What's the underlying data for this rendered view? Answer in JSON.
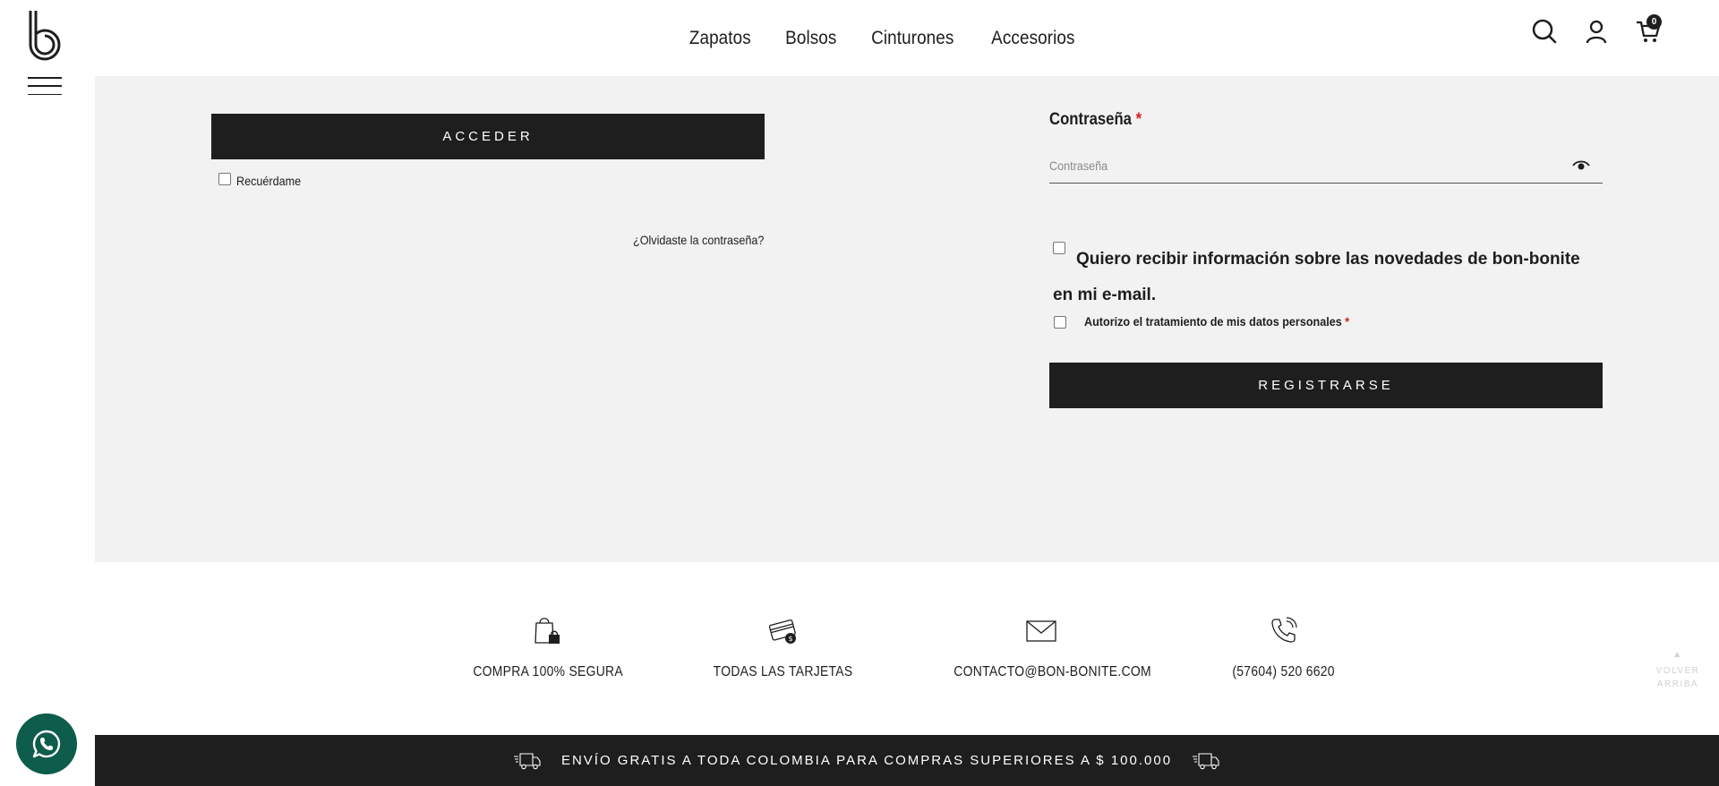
{
  "nav": {
    "items": [
      {
        "label": "Zapatos"
      },
      {
        "label": "Bolsos"
      },
      {
        "label": "Cinturones"
      },
      {
        "label": "Accesorios"
      }
    ],
    "cart_count": "0"
  },
  "login": {
    "submit_label": "ACCEDER",
    "remember_label": "Recuérdame",
    "forgot_label": "¿Olvidaste la contraseña?"
  },
  "register": {
    "password_label": "Contraseña",
    "required_mark": "*",
    "password_placeholder": "Contraseña",
    "newsletter_label": "Quiero recibir información sobre las novedades de bon-bonite en mi e-mail.",
    "consent_label": "Autorizo el tratamiento de mis datos personales",
    "submit_label": "REGISTRARSE"
  },
  "features": [
    {
      "icon": "secure-bag-icon",
      "label": "COMPRA 100% SEGURA"
    },
    {
      "icon": "credit-card-icon",
      "label": "TODAS LAS TARJETAS"
    },
    {
      "icon": "envelope-icon",
      "label": "CONTACTO@BON-BONITE.COM"
    },
    {
      "icon": "phone-icon",
      "label": "(57604) 520 6620"
    }
  ],
  "scroll_top": {
    "line1": "VOLVER",
    "line2": "ARRIBA"
  },
  "shipping_banner": "ENVÍO GRATIS A TODA COLOMBIA PARA COMPRAS SUPERIORES A $ 100.000",
  "colors": {
    "dark": "#1e1e1e",
    "panel": "#f2f2f2",
    "required": "#e02020",
    "whatsapp": "#0d5c4c"
  }
}
